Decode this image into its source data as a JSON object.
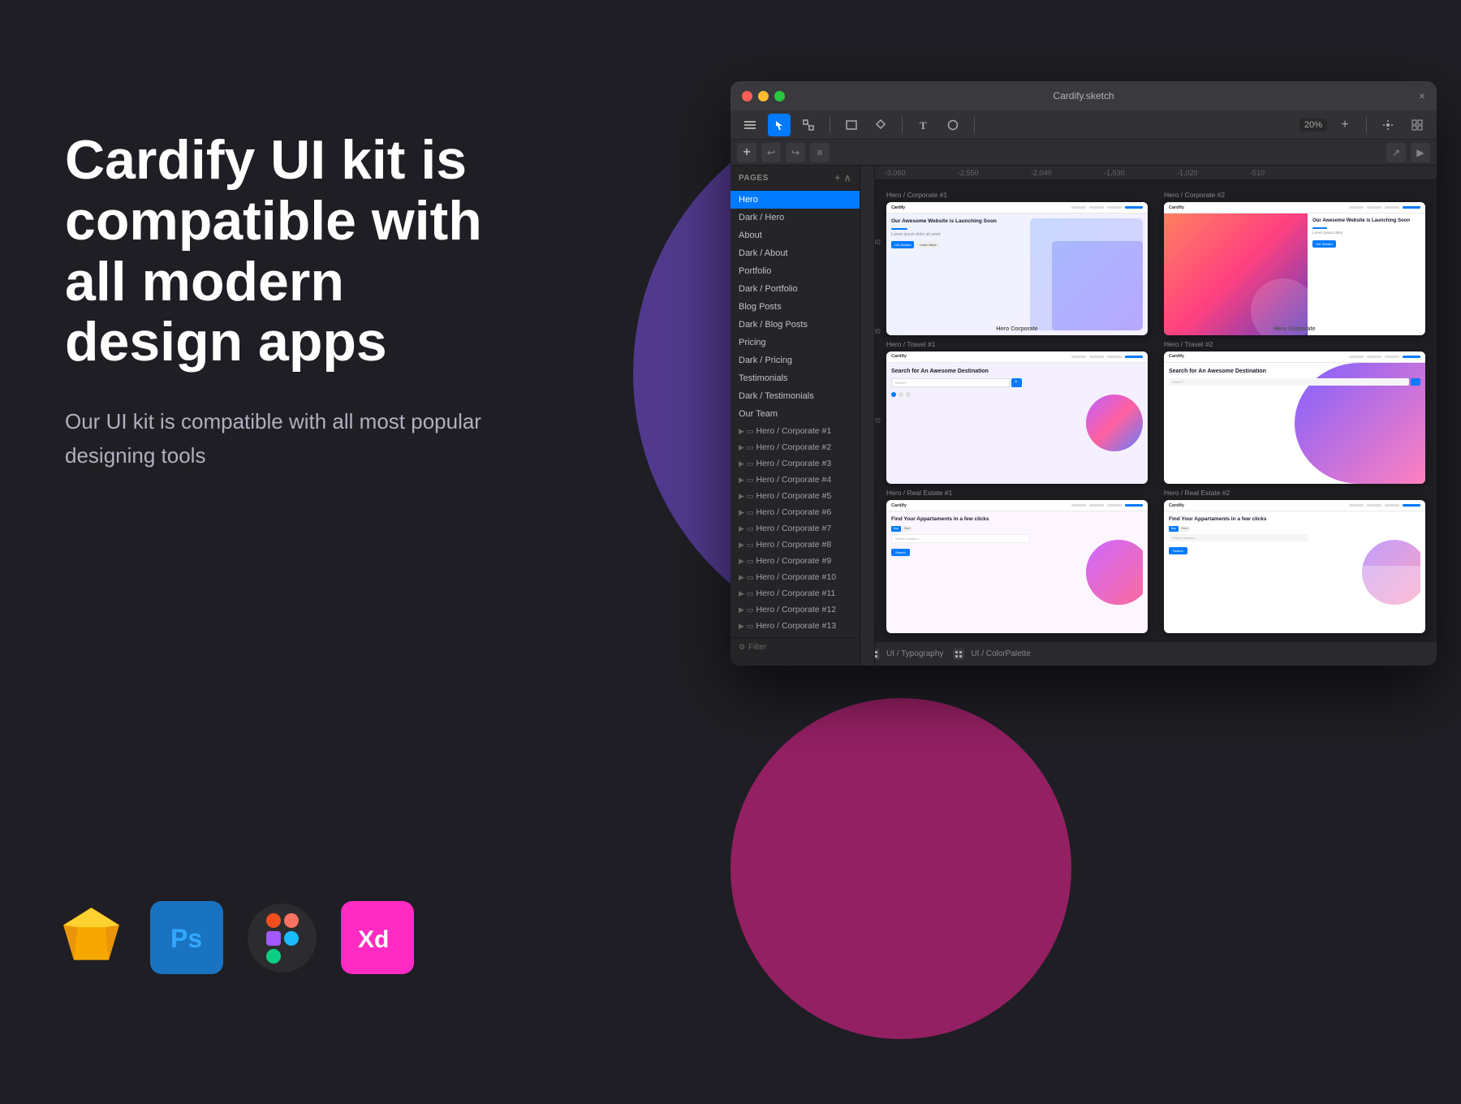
{
  "background": {
    "color": "#1e1e24"
  },
  "hero": {
    "heading": "Cardify UI kit is compatible with all modern design apps",
    "subtext": "Our UI kit is compatible with all most popular designing tools"
  },
  "tools": [
    {
      "name": "Sketch",
      "label": "Sketch",
      "icon": "sketch"
    },
    {
      "name": "Photoshop",
      "label": "Ps",
      "icon": "ps"
    },
    {
      "name": "Figma",
      "label": "Figma",
      "icon": "figma"
    },
    {
      "name": "Adobe XD",
      "label": "Xd",
      "icon": "xd"
    }
  ],
  "window": {
    "title": "Cardify.sketch",
    "close_btn": "×",
    "plus_btn": "+",
    "toolbar": {
      "zoom": "20%"
    }
  },
  "sidebar": {
    "header": "Pages",
    "items": [
      {
        "label": "Hero",
        "active": true
      },
      {
        "label": "Dark / Hero"
      },
      {
        "label": "About"
      },
      {
        "label": "Dark / About"
      },
      {
        "label": "Portfolio"
      },
      {
        "label": "Dark / Portfolio"
      },
      {
        "label": "Blog Posts"
      },
      {
        "label": "Dark / Blog Posts"
      },
      {
        "label": "Pricing"
      },
      {
        "label": "Dark / Pricing"
      },
      {
        "label": "Testimonials"
      },
      {
        "label": "Dark / Testimonials"
      },
      {
        "label": "Our Team"
      }
    ],
    "tree_items": [
      "Hero / Corporate #1",
      "Hero / Corporate #2",
      "Hero / Corporate #3",
      "Hero / Corporate #4",
      "Hero / Corporate #5",
      "Hero / Corporate #6",
      "Hero / Corporate #7",
      "Hero / Corporate #8",
      "Hero / Corporate #9",
      "Hero / Corporate #10",
      "Hero / Corporate #11",
      "Hero / Corporate #12",
      "Hero / Corporate #13"
    ]
  },
  "canvas": {
    "ruler_marks": [
      "-3,060",
      "-2,550",
      "-2,040",
      "-1,530",
      "-1,020",
      "-510"
    ],
    "thumbnails": [
      {
        "label": "Hero / Corporate #1",
        "hero_text": "Our Awesome Website is Launching Soon",
        "type": "corporate"
      },
      {
        "label": "Hero / Corporate #2",
        "hero_text": "Our Awesome Website is Launching Soon",
        "type": "corporate2"
      },
      {
        "label": "Hero / Travel #1",
        "hero_text": "Search for An Awesome Destination",
        "type": "travel"
      },
      {
        "label": "Hero / Travel #2",
        "hero_text": "Search for An Awesome Destination",
        "type": "travel2"
      },
      {
        "label": "Hero / Real Estate #1",
        "hero_text": "Find Your Appartaments in a few clicks",
        "type": "realestate"
      },
      {
        "label": "Hero / Real Estate #2",
        "hero_text": "Find Your Appartaments in a few clicks",
        "type": "realestate2"
      }
    ]
  },
  "bottom_bar": {
    "items": [
      {
        "label": "UI / Typography"
      },
      {
        "label": "UI / ColorPalette"
      }
    ]
  },
  "hero_corporate_labels": {
    "first": "Hero Corporate",
    "second": "Hero Corporate"
  }
}
